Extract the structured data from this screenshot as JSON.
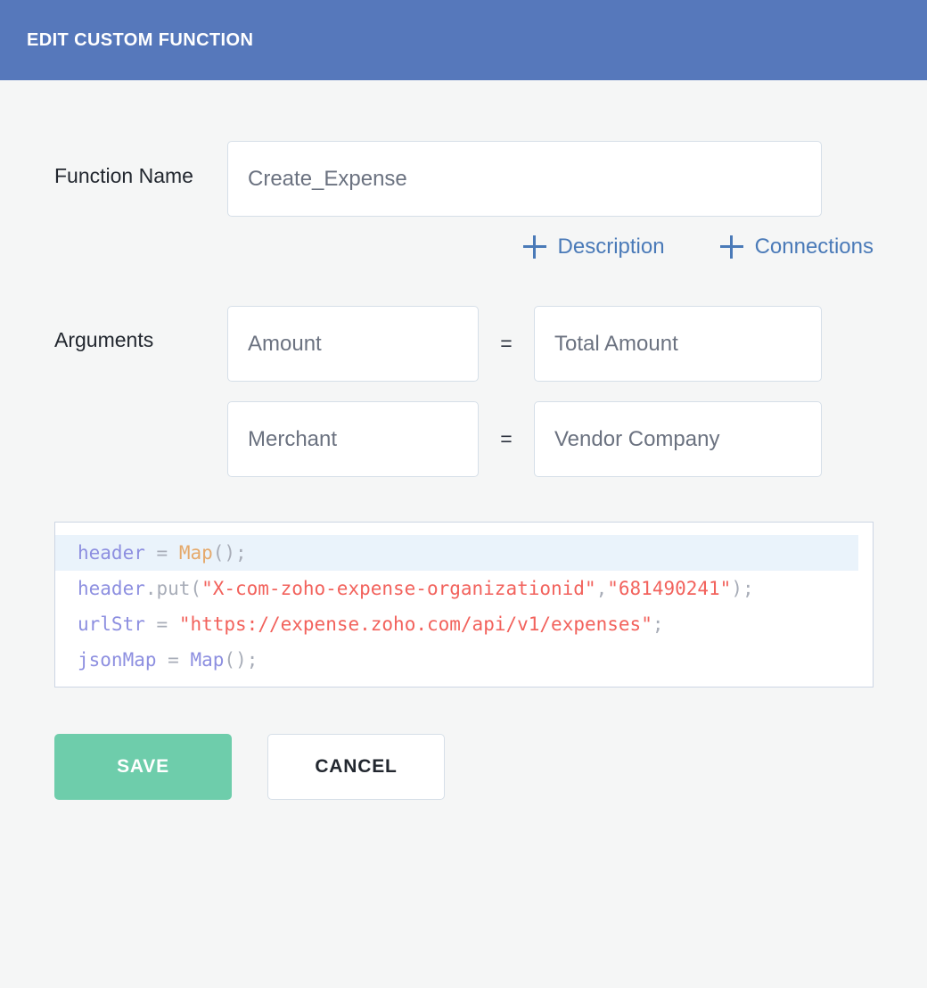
{
  "header": {
    "title": "EDIT CUSTOM FUNCTION",
    "background": "#5678bb"
  },
  "form": {
    "function_name": {
      "label": "Function Name",
      "value": "Create_Expense"
    },
    "links": [
      {
        "icon": "plus-icon",
        "label": "Description"
      },
      {
        "icon": "plus-icon",
        "label": "Connections"
      }
    ],
    "arguments": {
      "label": "Arguments",
      "separator": "=",
      "rows": [
        {
          "key": "Amount",
          "value": "Total Amount"
        },
        {
          "key": "Merchant",
          "value": "Vendor Company"
        }
      ]
    }
  },
  "code_editor": {
    "active_line_index": 0,
    "lines": [
      {
        "tokens": [
          {
            "text": "header",
            "type": "id"
          },
          {
            "text": " ",
            "type": "pun"
          },
          {
            "text": "=",
            "type": "pun"
          },
          {
            "text": " ",
            "type": "pun"
          },
          {
            "text": "Map",
            "type": "type"
          },
          {
            "text": "();",
            "type": "pun"
          }
        ]
      },
      {
        "tokens": [
          {
            "text": "header",
            "type": "id"
          },
          {
            "text": ".put(",
            "type": "pun"
          },
          {
            "text": "\"X-com-zoho-expense-organizationid\"",
            "type": "str"
          },
          {
            "text": ",",
            "type": "pun"
          },
          {
            "text": "\"681490241\"",
            "type": "str"
          },
          {
            "text": ");",
            "type": "pun"
          }
        ]
      },
      {
        "tokens": [
          {
            "text": "urlStr",
            "type": "id"
          },
          {
            "text": " ",
            "type": "pun"
          },
          {
            "text": "=",
            "type": "pun"
          },
          {
            "text": " ",
            "type": "pun"
          },
          {
            "text": "\"https://expense.zoho.com/api/v1/expenses\"",
            "type": "str"
          },
          {
            "text": ";",
            "type": "pun"
          }
        ]
      },
      {
        "tokens": [
          {
            "text": "jsonMap",
            "type": "id"
          },
          {
            "text": " ",
            "type": "pun"
          },
          {
            "text": "=",
            "type": "pun"
          },
          {
            "text": " ",
            "type": "pun"
          },
          {
            "text": "Map",
            "type": "id"
          },
          {
            "text": "();",
            "type": "pun"
          }
        ]
      }
    ]
  },
  "actions": {
    "save_label": "SAVE",
    "save_color": "#6ecdab",
    "cancel_label": "CANCEL"
  }
}
